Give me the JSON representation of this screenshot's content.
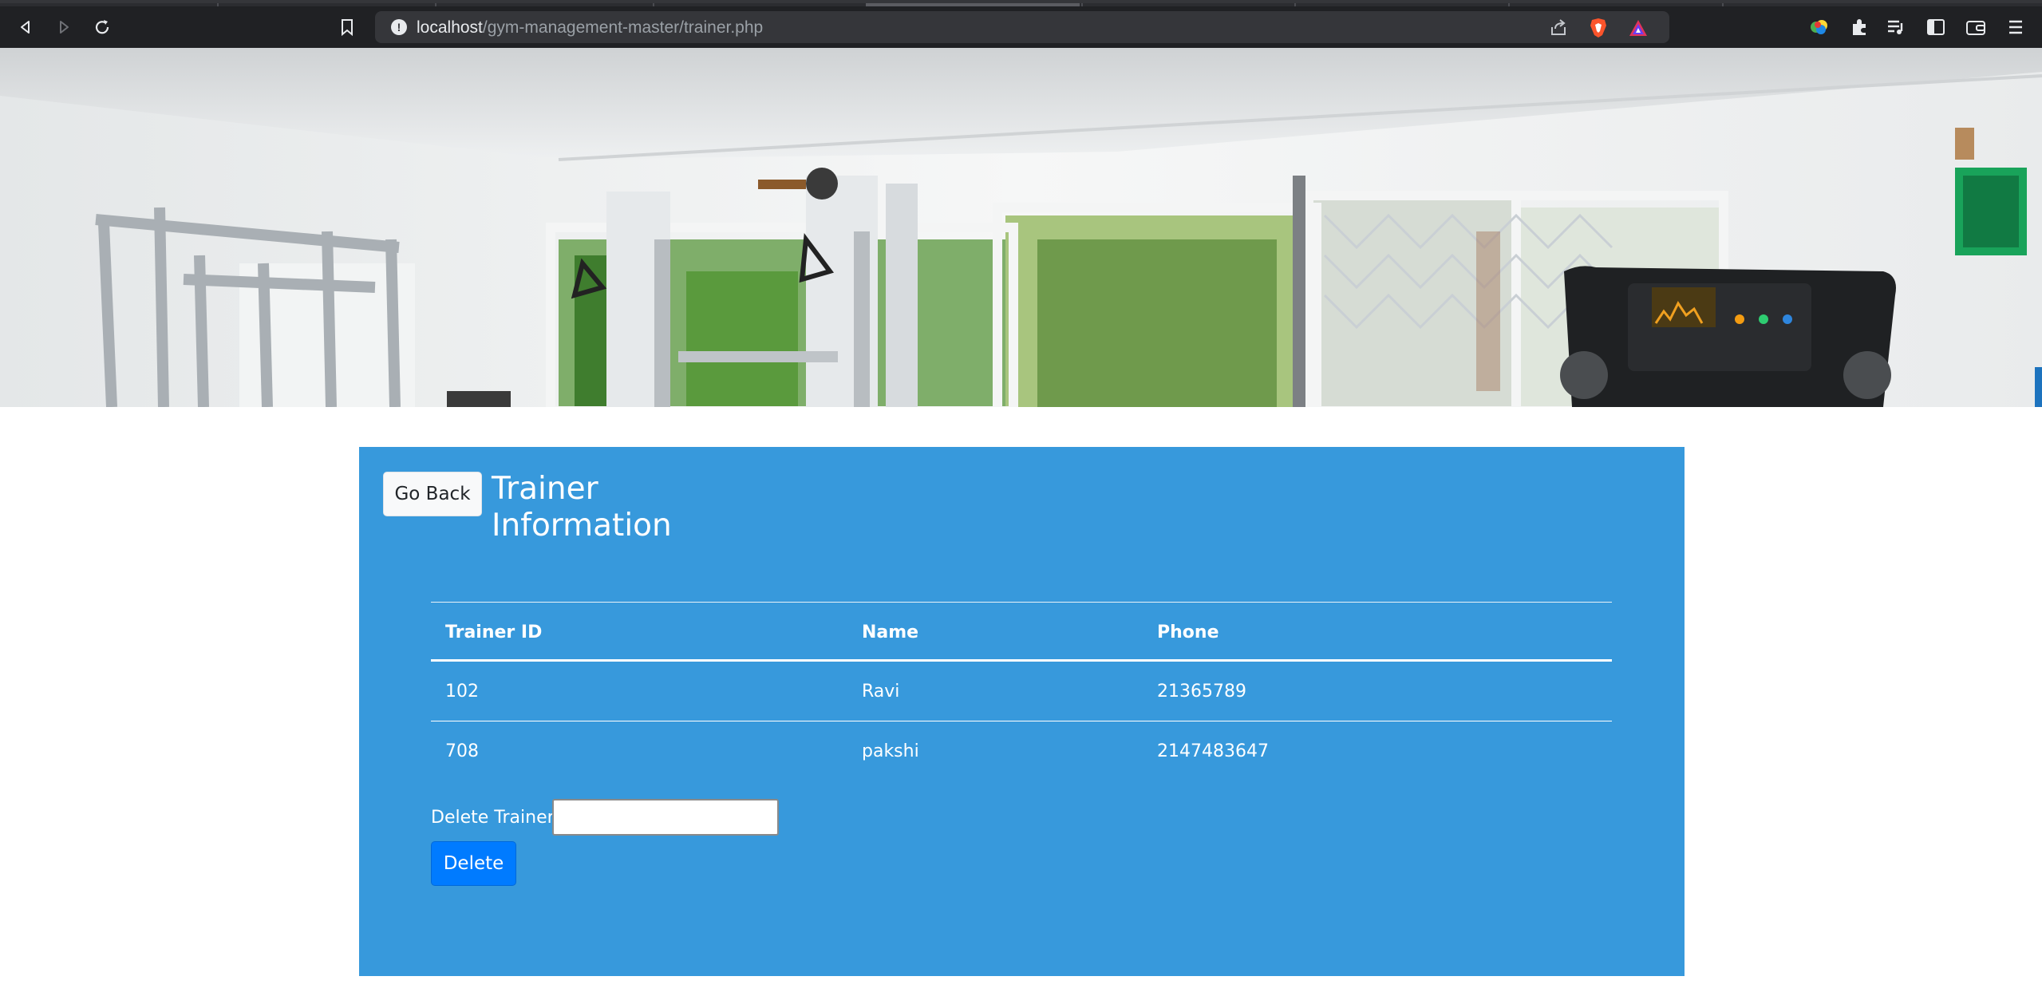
{
  "browser": {
    "url_host": "localhost",
    "url_path": "/gym-management-master/trainer.php",
    "icons": [
      "back-icon",
      "forward-icon",
      "reload-icon",
      "bookmark-icon",
      "site-info-icon",
      "share-icon",
      "brave-shields-icon",
      "brave-rewards-icon",
      "color-extension-icon",
      "extensions-icon",
      "playlist-icon",
      "sidebar-icon",
      "wallet-icon",
      "menu-icon"
    ]
  },
  "hero": {
    "image": "gym-interior-photo"
  },
  "panel": {
    "go_back_label": "Go Back",
    "title_line1": "Trainer",
    "title_line2": "Information",
    "background": "#3799dc"
  },
  "table": {
    "headers": [
      "Trainer ID",
      "Name",
      "Phone"
    ],
    "rows": [
      [
        "102",
        "Ravi",
        "21365789"
      ],
      [
        "708",
        "pakshi",
        "2147483647"
      ]
    ]
  },
  "delete_form": {
    "label": "Delete Trainer",
    "input_value": "",
    "button_label": "Delete",
    "button_color": "#007bff"
  }
}
